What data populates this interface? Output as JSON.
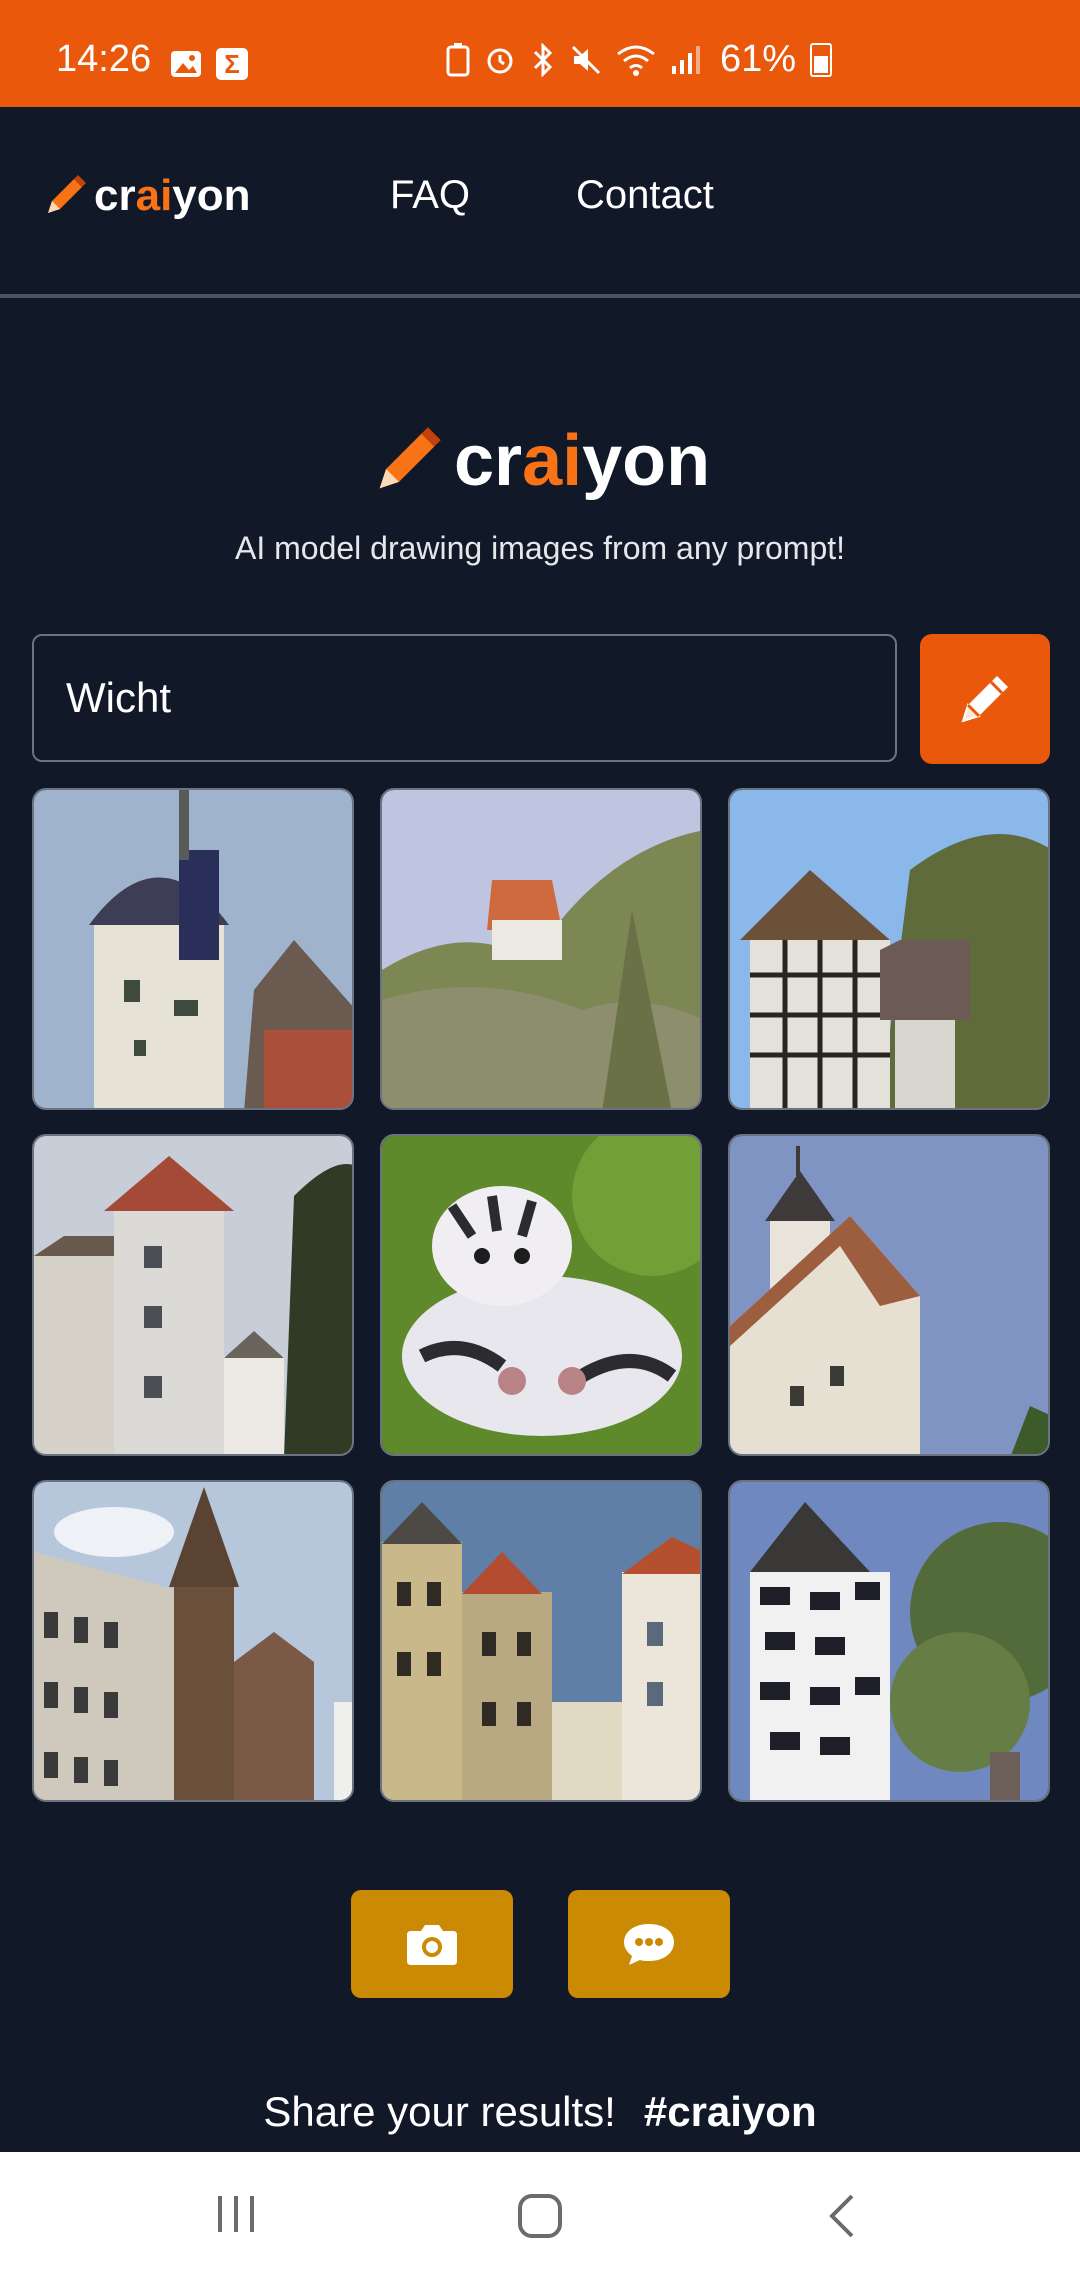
{
  "status_bar": {
    "time": "14:26",
    "battery_percent": "61%",
    "left_icons": [
      "gallery-icon",
      "sigma-icon"
    ],
    "right_icons": [
      "recycle-icon",
      "alarm-icon",
      "bluetooth-icon",
      "mute-icon",
      "wifi-icon",
      "signal-icon",
      "battery-icon"
    ]
  },
  "nav": {
    "logo_prefix": "cr",
    "logo_ai": "ai",
    "logo_suffix": "yon",
    "faq": "FAQ",
    "contact": "Contact"
  },
  "hero": {
    "logo_prefix": "cr",
    "logo_ai": "ai",
    "logo_suffix": "yon",
    "tagline": "AI model drawing images from any prompt!"
  },
  "prompt": {
    "value": "Wicht"
  },
  "results": [
    {
      "subject": "white tower with dark dome"
    },
    {
      "subject": "trees with red roof"
    },
    {
      "subject": "half-timbered house"
    },
    {
      "subject": "white tower building"
    },
    {
      "subject": "fluffy striped creature"
    },
    {
      "subject": "tall white tower church"
    },
    {
      "subject": "street with church spire"
    },
    {
      "subject": "old town houses"
    },
    {
      "subject": "black and white tower"
    }
  ],
  "actions": {
    "screenshot_icon": "camera-icon",
    "feedback_icon": "chat-icon"
  },
  "share": {
    "text": "Share your results!",
    "hashtag": "#craiyon"
  },
  "colors": {
    "accent": "#ea580c",
    "background": "#111827",
    "action_buttons": "#ca8a04"
  }
}
